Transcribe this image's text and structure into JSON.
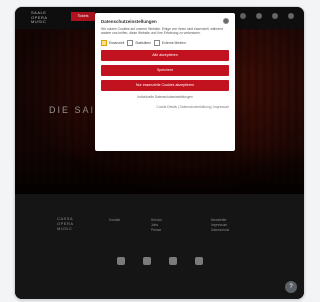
{
  "header": {
    "logo_lines": [
      "SAALE",
      "OPERA",
      "MUSIC"
    ],
    "nav_cta": "Tickets"
  },
  "hero": {
    "title": "DIE SAISON"
  },
  "consent": {
    "title": "Datenschutzeinstellungen",
    "text": "Wir nutzen Cookies auf unserer Website. Einige von ihnen sind essenziell, während andere uns helfen, diese Website und Ihre Erfahrung zu verbessern.",
    "checkboxes": [
      {
        "label": "Essenziell",
        "checked": true
      },
      {
        "label": "Statistiken",
        "checked": false
      },
      {
        "label": "Externe Medien",
        "checked": false
      }
    ],
    "buttons": [
      "Alle akzeptieren",
      "Speichern",
      "Nur essenzielle Cookies akzeptieren"
    ],
    "more_info": "Individuelle Datenschutzeinstellungen",
    "links": "Cookie-Details | Datenschutzerklärung | Impressum"
  },
  "footer": {
    "logo_lines": [
      "CASSA",
      "OPERA",
      "MUSIC"
    ],
    "col1": [
      "Kontakt"
    ],
    "col2": [
      "Service",
      "Jobs",
      "Presse"
    ],
    "col3": [
      "Newsletter",
      "Impressum",
      "Datenschutz"
    ],
    "help": "?"
  },
  "colors": {
    "accent_red": "#c2121f",
    "bg_dark": "#111111",
    "hero_red": "#8a1f12"
  }
}
